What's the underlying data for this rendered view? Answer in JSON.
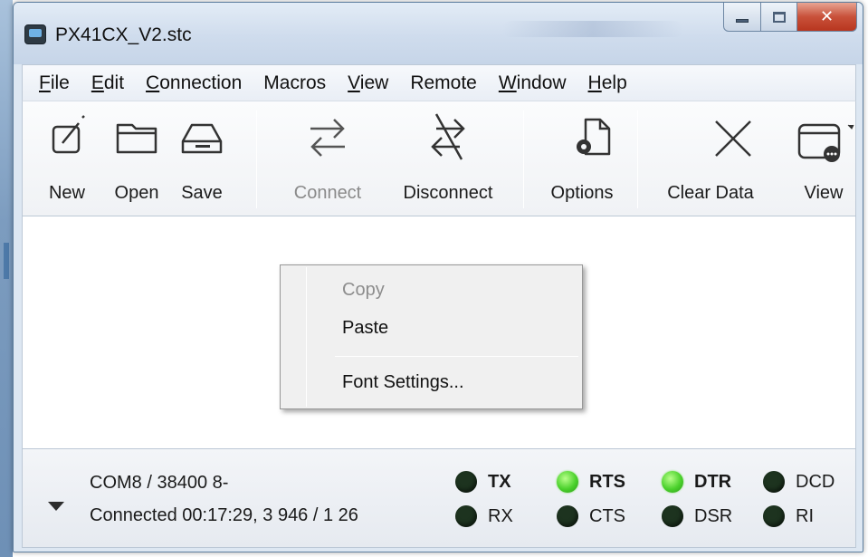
{
  "window": {
    "title": "PX41CX_V2.stc"
  },
  "menu": [
    {
      "label": "File",
      "underline": "F",
      "rest": "ile"
    },
    {
      "label": "Edit",
      "underline": "E",
      "rest": "dit"
    },
    {
      "label": "Connection",
      "underline": "C",
      "rest": "onnection"
    },
    {
      "label": "Macros",
      "underline": "",
      "rest": "Macros"
    },
    {
      "label": "View",
      "underline": "V",
      "rest": "iew"
    },
    {
      "label": "Remote",
      "underline": "",
      "rest": "Remote"
    },
    {
      "label": "Window",
      "underline": "W",
      "rest": "indow"
    },
    {
      "label": "Help",
      "underline": "H",
      "rest": "elp"
    }
  ],
  "toolbar": {
    "new_label": "New",
    "open_label": "Open",
    "save_label": "Save",
    "connect_label": "Connect",
    "disconnect_label": "Disconnect",
    "options_label": "Options",
    "clear_label": "Clear Data",
    "view_label": "View"
  },
  "context_menu": {
    "copy_label": "Copy",
    "paste_label": "Paste",
    "font_settings_label": "Font Settings..."
  },
  "status": {
    "port_line": "COM8 / 38400 8-",
    "connection_line": "Connected 00:17:29, 3 946 / 1 26",
    "leds": {
      "tx": {
        "label": "TX",
        "on": false,
        "bold": true
      },
      "rx": {
        "label": "RX",
        "on": false,
        "bold": false
      },
      "rts": {
        "label": "RTS",
        "on": true,
        "bold": true
      },
      "cts": {
        "label": "CTS",
        "on": false,
        "bold": false
      },
      "dtr": {
        "label": "DTR",
        "on": true,
        "bold": true
      },
      "dsr": {
        "label": "DSR",
        "on": false,
        "bold": false
      },
      "dcd": {
        "label": "DCD",
        "on": false,
        "bold": false
      },
      "ri": {
        "label": "RI",
        "on": false,
        "bold": false
      }
    },
    "led_on_color": "#4bd12c",
    "led_off_color": "#1d331f"
  },
  "icons": {
    "new": "new-document-icon",
    "open": "folder-icon",
    "save": "drive-icon",
    "connect": "connect-arrows-icon",
    "disconnect": "disconnect-arrows-icon",
    "options": "options-gear-icon",
    "clear": "clear-x-icon",
    "view": "view-window-icon"
  }
}
